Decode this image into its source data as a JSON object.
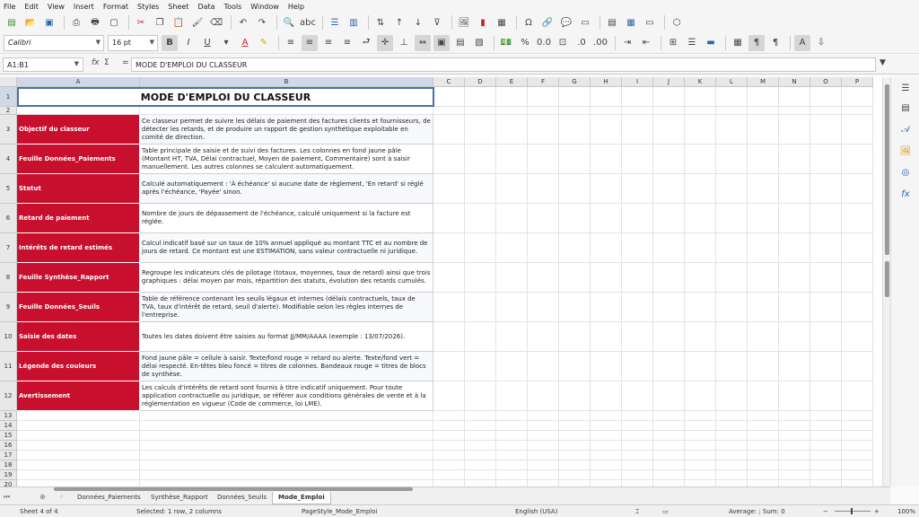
{
  "menu": [
    "File",
    "Edit",
    "View",
    "Insert",
    "Format",
    "Styles",
    "Sheet",
    "Data",
    "Tools",
    "Window",
    "Help"
  ],
  "font": {
    "name": "Calibri",
    "size": "16 pt"
  },
  "formula": {
    "name_box": "A1:B1",
    "fx": "fx",
    "sum": "Σ",
    "eq": "=",
    "content": "MODE D'EMPLOI DU CLASSEUR"
  },
  "columns": [
    "A",
    "B",
    "C",
    "D",
    "E",
    "F",
    "G",
    "H",
    "I",
    "J",
    "K",
    "L",
    "M",
    "N",
    "O",
    "P"
  ],
  "title": "MODE D'EMPLOI DU CLASSEUR",
  "rows": [
    {
      "num": "1"
    },
    {
      "num": "2"
    },
    {
      "num": "3",
      "label": "Objectif du classeur",
      "text": "Ce classeur permet de suivre les délais de paiement des factures clients et fournisseurs, de détecter les retards, et de produire un rapport de gestion synthétique exploitable en comité de direction."
    },
    {
      "num": "4",
      "label": "Feuille Données_Paiements",
      "text": "Table principale de saisie et de suivi des factures. Les colonnes en fond jaune pâle (Montant HT, TVA, Délai contractuel, Moyen de paiement, Commentaire) sont à saisir manuellement. Les autres colonnes se calculent automatiquement."
    },
    {
      "num": "5",
      "label": "Statut",
      "text": "Calculé automatiquement : 'À échéance' si aucune date de règlement, 'En retard' si réglé après l'échéance, 'Payée' sinon."
    },
    {
      "num": "6",
      "label": "Retard de paiement",
      "text": "Nombre de jours de dépassement de l'échéance, calculé uniquement si la facture est réglée."
    },
    {
      "num": "7",
      "label": "Intérêts de retard estimés",
      "text": "Calcul indicatif basé sur un taux de 10% annuel appliqué au montant TTC et au nombre de jours de retard. Ce montant est une ESTIMATION, sans valeur contractuelle ni juridique."
    },
    {
      "num": "8",
      "label": "Feuille Synthèse_Rapport",
      "text": "Regroupe les indicateurs clés de pilotage (totaux, moyennes, taux de retard) ainsi que trois graphiques : délai moyen par mois, répartition des statuts, évolution des retards cumulés."
    },
    {
      "num": "9",
      "label": "Feuille Données_Seuils",
      "text": "Table de référence contenant les seuils légaux et internes (délais contractuels, taux de TVA, taux d'intérêt de retard, seuil d'alerte). Modifiable selon les règles internes de l'entreprise."
    },
    {
      "num": "10",
      "label": "Saisie des dates",
      "text": "Toutes les dates doivent être saisies au format JJ/MM/AAAA (exemple : 13/07/2026)."
    },
    {
      "num": "11",
      "label": "Légende des couleurs",
      "text": "Fond jaune pâle = cellule à saisir. Texte/fond rouge = retard ou alerte. Texte/fond vert = délai respecté. En-têtes bleu foncé = titres de colonnes. Bandeaux rouge = titres de blocs de synthèse."
    },
    {
      "num": "12",
      "label": "Avertissement",
      "text": "Les calculs d'intérêts de retard sont fournis à titre indicatif uniquement. Pour toute application contractuelle ou juridique, se référer aux conditions générales de vente et à la réglementation en vigueur (Code de commerce, loi LME)."
    },
    {
      "num": "13"
    },
    {
      "num": "14"
    },
    {
      "num": "15"
    },
    {
      "num": "16"
    },
    {
      "num": "17"
    },
    {
      "num": "18"
    },
    {
      "num": "19"
    },
    {
      "num": "20"
    }
  ],
  "sheets": [
    "Données_Paiements",
    "Synthèse_Rapport",
    "Données_Seuils",
    "Mode_Emploi"
  ],
  "active_sheet": "Mode_Emploi",
  "status": {
    "sheet": "Sheet 4 of 4",
    "selection": "Selected: 1 row, 2 columns",
    "pagestyle": "PageStyle_Mode_Emploi",
    "language": "English (USA)",
    "sum": "Average: ; Sum: 0",
    "zoom": "100%"
  },
  "colors": {
    "label_bg": "#c8102e",
    "selection": "#4a6fa5"
  }
}
